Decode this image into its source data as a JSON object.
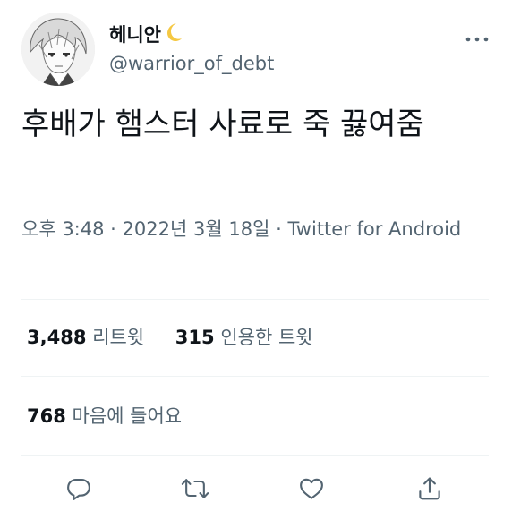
{
  "user": {
    "display_name": "헤니안",
    "moon_icon": "crescent-moon-icon",
    "handle": "@warrior_of_debt"
  },
  "tweet": {
    "text": "후배가 햄스터 사료로 죽 끓여줌",
    "time": "오후 3:48",
    "separator1": "·",
    "date": "2022년 3월 18일",
    "separator2": "·",
    "source": "Twitter for Android"
  },
  "stats": {
    "retweets_count": "3,488",
    "retweets_label": "리트윗",
    "quotes_count": "315",
    "quotes_label": "인용한 트윗",
    "likes_count": "768",
    "likes_label": "마음에 들어요"
  },
  "colors": {
    "text": "#0f1419",
    "secondary": "#536471",
    "divider": "#eff3f4",
    "moon": "#f5c842"
  },
  "icons": [
    "more-icon",
    "reply-icon",
    "retweet-icon",
    "like-icon",
    "share-icon"
  ]
}
